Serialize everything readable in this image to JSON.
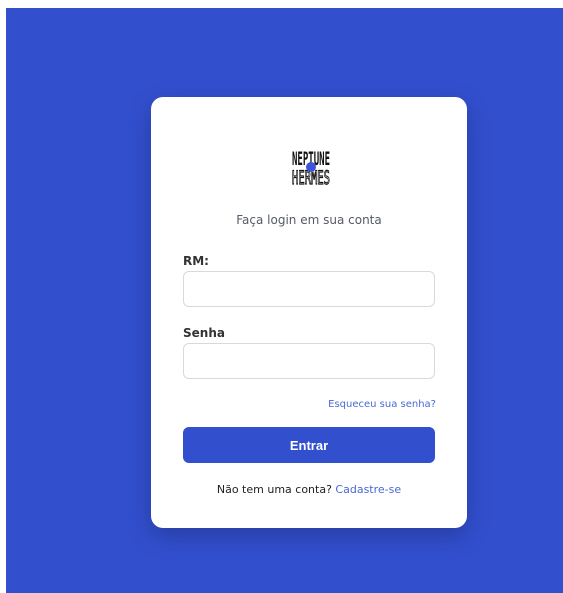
{
  "colors": {
    "background": "#324fce",
    "card": "#ffffff",
    "button": "#324fce",
    "link": "#4a68d6"
  },
  "logo": {
    "top_text": "NEPTUNE",
    "bottom_text": "HERMES",
    "icon": "planet-dot-icon"
  },
  "login": {
    "subtitle": "Faça login em sua conta",
    "rm_label": "RM:",
    "rm_value": "",
    "senha_label": "Senha",
    "senha_value": "",
    "forgot_link": "Esqueceu sua senha?",
    "submit_label": "Entrar",
    "register_prompt": "Não tem uma conta?",
    "register_link": "Cadastre-se"
  }
}
